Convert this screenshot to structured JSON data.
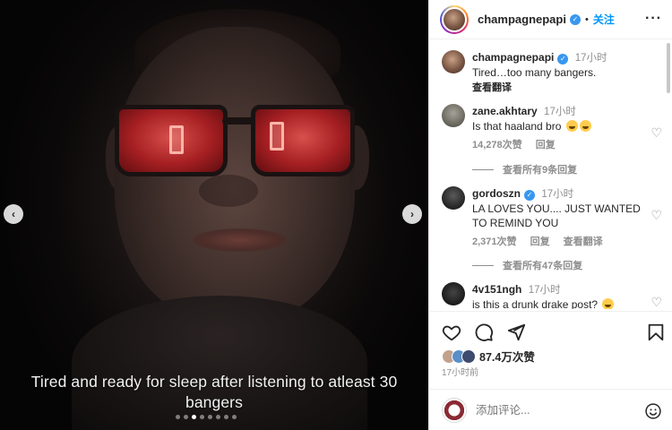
{
  "media": {
    "caption_line1": "Tired and ready for sleep after listening to atleast 30",
    "caption_line2": "bangers",
    "prev_icon": "chevron-left-icon",
    "next_icon": "chevron-right-icon",
    "carousel": {
      "count": 8,
      "active": 2
    }
  },
  "header": {
    "username": "champagnepapi",
    "verified": true,
    "separator": "•",
    "follow_label": "关注",
    "more_icon": "more-horizontal-icon",
    "more_glyph": "···"
  },
  "caption": {
    "username": "champagnepapi",
    "time": "17小时",
    "text": "Tired…too many bangers.",
    "translate": "查看翻译"
  },
  "comments": [
    {
      "username": "zane.akhtary",
      "time": "17小时",
      "text": "Is that haaland bro",
      "emoji": "crying-laughing-emoji x2",
      "likes": "14,278次赞",
      "reply": "回复",
      "replies": "查看所有9条回复"
    },
    {
      "username": "gordoszn",
      "time": "17小时",
      "text": "LA LOVES YOU.... JUST WANTED TO REMIND YOU",
      "likes": "2,371次赞",
      "reply": "回复",
      "translate": "查看翻译",
      "replies": "查看所有47条回复"
    },
    {
      "username": "4v151ngh",
      "time": "17小时",
      "text": "is this a drunk drake post?",
      "emoji": "laughing-emoji"
    }
  ],
  "actions": {
    "like_icon": "heart-icon",
    "comment_icon": "comment-icon",
    "share_icon": "send-icon",
    "save_icon": "bookmark-icon",
    "likes_count": "87.4万次赞",
    "post_time": "17小时前"
  },
  "composer": {
    "placeholder": "添加评论...",
    "emoji_icon": "smiley-icon"
  },
  "colors": {
    "link_blue": "#0095f6",
    "verified_blue": "#3897f0",
    "muted_text": "#8e8e8e",
    "text": "#262626"
  }
}
